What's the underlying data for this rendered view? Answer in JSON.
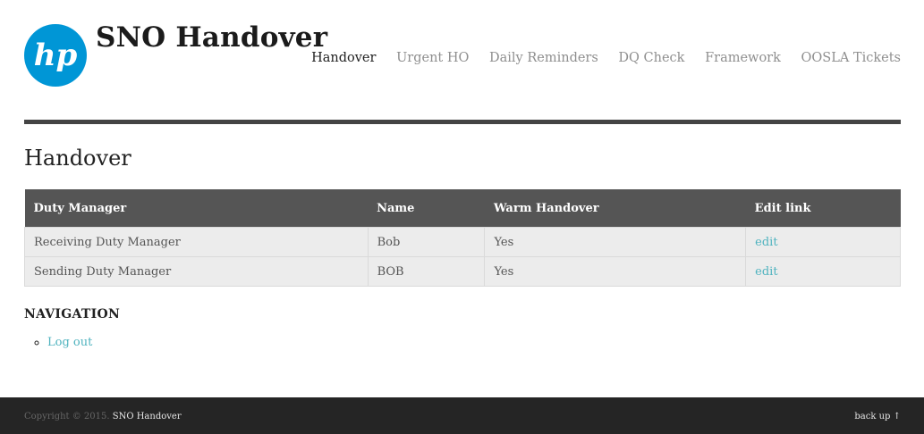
{
  "site": {
    "title": "SNO Handover",
    "brand_color": "#0096d6"
  },
  "nav": {
    "items": [
      {
        "label": "Handover",
        "active": true
      },
      {
        "label": "Urgent HO"
      },
      {
        "label": "Daily Reminders"
      },
      {
        "label": "DQ Check"
      },
      {
        "label": "Framework"
      },
      {
        "label": "OOSLA Tickets"
      }
    ]
  },
  "main": {
    "page_title": "Handover",
    "table": {
      "headers": [
        "Duty Manager",
        "Name",
        "Warm Handover",
        "Edit link"
      ],
      "rows": [
        [
          "Receiving Duty Manager",
          "Bob",
          "Yes",
          "edit"
        ],
        [
          "Sending Duty Manager",
          "BOB",
          "Yes",
          "edit"
        ]
      ]
    }
  },
  "sidebar": {
    "heading": "NAVIGATION",
    "links": [
      "Log out"
    ]
  },
  "footer": {
    "copyright": "Copyright © 2015.",
    "site_name": "SNO Handover",
    "back_up": "back up ↑"
  }
}
